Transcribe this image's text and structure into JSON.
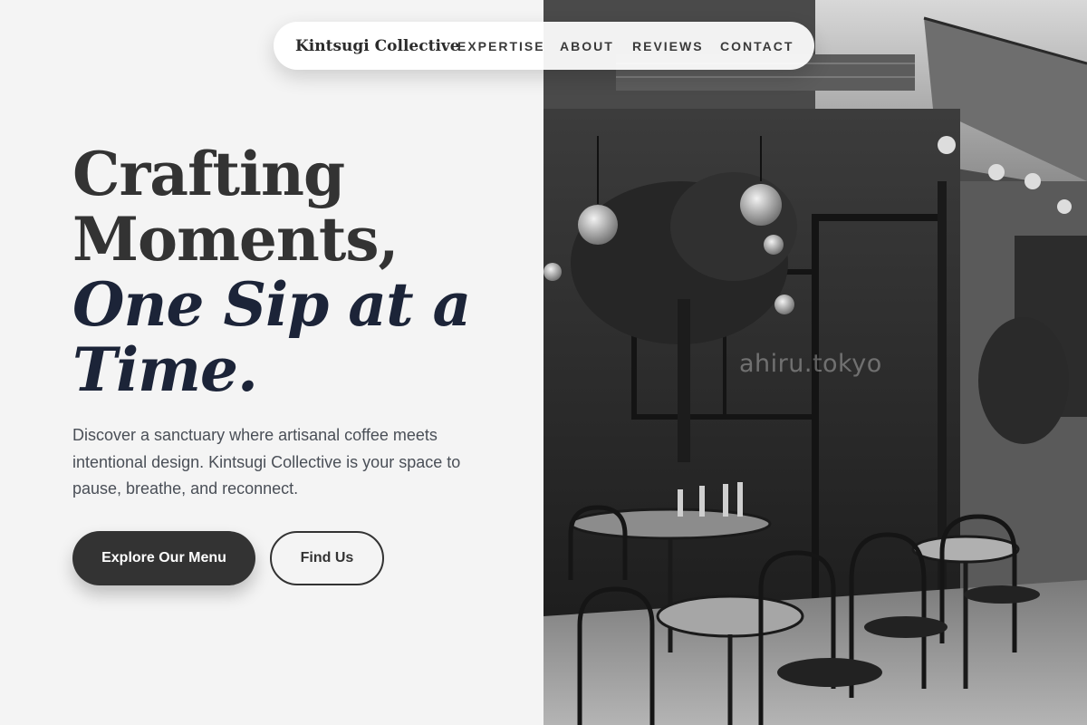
{
  "navbar": {
    "brand": "Kintsugi Collective",
    "links": [
      "EXPERTISE",
      "ABOUT",
      "REVIEWS",
      "CONTACT"
    ]
  },
  "hero": {
    "headline_lines": [
      "Crafting",
      "Moments,"
    ],
    "headline_accent_lines": [
      "One Sip at a",
      "Time."
    ],
    "description": "Discover a sanctuary where artisanal coffee meets intentional design. Kintsugi Collective is your space to pause, breathe, and reconnect.",
    "primary_cta": "Explore Our Menu",
    "secondary_cta": "Find Us"
  },
  "image": {
    "watermark": "ahiru.tokyo"
  },
  "colors": {
    "background": "#f4f4f4",
    "heading": "#333333",
    "accent": "#1c2438",
    "body_text": "#4a4f57",
    "button_dark": "#333333"
  }
}
